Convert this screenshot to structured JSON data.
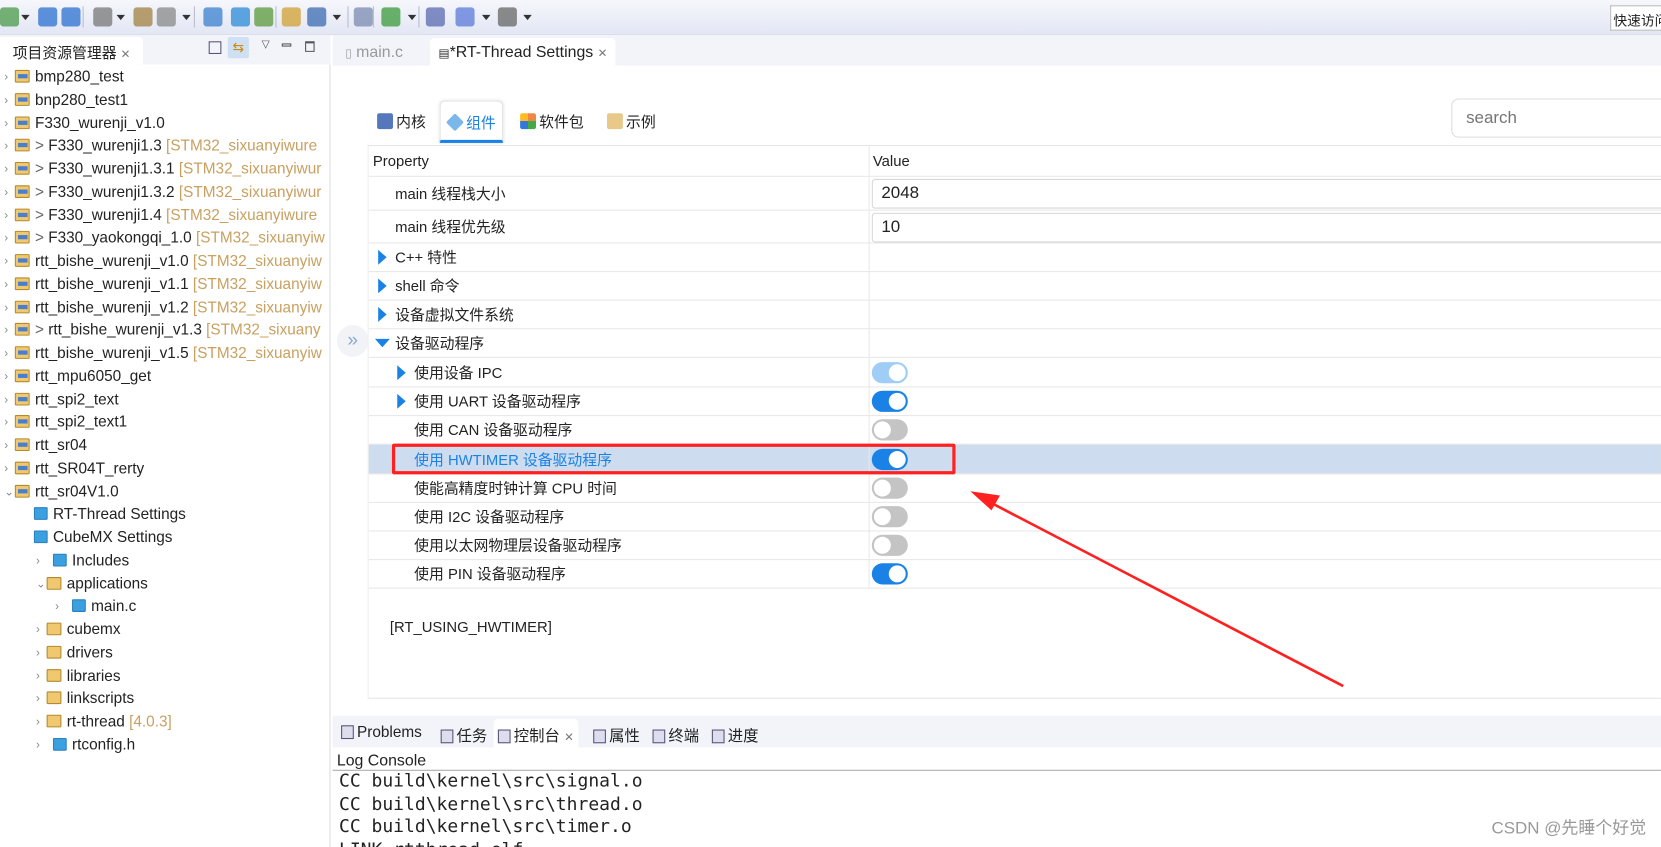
{
  "toolbar": {
    "quick_access": "快速访问"
  },
  "project_explorer": {
    "title": "项目资源管理器",
    "items": [
      {
        "name": "bmp280_test",
        "prefix": "",
        "decoration": ""
      },
      {
        "name": "bnp280_test1",
        "prefix": "",
        "decoration": ""
      },
      {
        "name": "F330_wurenji_v1.0",
        "prefix": "",
        "decoration": ""
      },
      {
        "name": "F330_wurenji1.3",
        "prefix": "> ",
        "decoration": "[STM32_sixuanyiwure"
      },
      {
        "name": "F330_wurenji1.3.1",
        "prefix": "> ",
        "decoration": "[STM32_sixuanyiwur"
      },
      {
        "name": "F330_wurenji1.3.2",
        "prefix": "> ",
        "decoration": "[STM32_sixuanyiwur"
      },
      {
        "name": "F330_wurenji1.4",
        "prefix": "> ",
        "decoration": "[STM32_sixuanyiwure"
      },
      {
        "name": "F330_yaokongqi_1.0",
        "prefix": "> ",
        "decoration": "[STM32_sixuanyiw"
      },
      {
        "name": "rtt_bishe_wurenji_v1.0",
        "prefix": "",
        "decoration": "[STM32_sixuanyiw"
      },
      {
        "name": "rtt_bishe_wurenji_v1.1",
        "prefix": "",
        "decoration": "[STM32_sixuanyiw"
      },
      {
        "name": "rtt_bishe_wurenji_v1.2",
        "prefix": "",
        "decoration": "[STM32_sixuanyiw"
      },
      {
        "name": "rtt_bishe_wurenji_v1.3",
        "prefix": "> ",
        "decoration": "[STM32_sixuany"
      },
      {
        "name": "rtt_bishe_wurenji_v1.5",
        "prefix": "",
        "decoration": "[STM32_sixuanyiw"
      },
      {
        "name": "rtt_mpu6050_get",
        "prefix": "",
        "decoration": ""
      },
      {
        "name": "rtt_spi2_text",
        "prefix": "",
        "decoration": ""
      },
      {
        "name": "rtt_spi2_text1",
        "prefix": "",
        "decoration": ""
      },
      {
        "name": "rtt_sr04",
        "prefix": "",
        "decoration": ""
      },
      {
        "name": "rtt_SR04T_rerty",
        "prefix": "",
        "decoration": ""
      },
      {
        "name": "rtt_sr04V1.0",
        "prefix": "",
        "decoration": ""
      }
    ],
    "children": [
      {
        "name": "RT-Thread Settings",
        "decoration": "",
        "icon": "rt-settings-icon"
      },
      {
        "name": "CubeMX Settings",
        "decoration": "",
        "icon": "cubemx-icon"
      },
      {
        "name": "Includes",
        "decoration": "",
        "icon": "includes-icon"
      },
      {
        "name": "applications",
        "decoration": "",
        "icon": "folder-icon"
      },
      {
        "name": "main.c",
        "decoration": "",
        "icon": "c-file-icon"
      },
      {
        "name": "cubemx",
        "decoration": "",
        "icon": "folder-icon"
      },
      {
        "name": "drivers",
        "decoration": "",
        "icon": "folder-icon"
      },
      {
        "name": "libraries",
        "decoration": "",
        "icon": "folder-icon"
      },
      {
        "name": "linkscripts",
        "decoration": "",
        "icon": "folder-icon"
      },
      {
        "name": "rt-thread",
        "decoration": "[4.0.3]",
        "icon": "folder-icon"
      },
      {
        "name": "rtconfig.h",
        "decoration": "",
        "icon": "h-file-icon"
      }
    ]
  },
  "editor_tabs": [
    {
      "label": "main.c",
      "active": false
    },
    {
      "label": "*RT-Thread Settings",
      "active": true
    }
  ],
  "settings": {
    "tabs": [
      {
        "label": "内核",
        "active": false
      },
      {
        "label": "组件",
        "active": true
      },
      {
        "label": "软件包",
        "active": false
      },
      {
        "label": "示例",
        "active": false
      }
    ],
    "search_placeholder": "search",
    "columns": {
      "property": "Property",
      "value": "Value"
    },
    "rows": [
      {
        "label": "main 线程栈大小",
        "value": "2048"
      },
      {
        "label": "main 线程优先级",
        "value": "10"
      },
      {
        "label": "C++ 特性"
      },
      {
        "label": "shell 命令"
      },
      {
        "label": "设备虚拟文件系统"
      },
      {
        "label": "设备驱动程序",
        "expanded": true
      },
      {
        "label": "使用设备 IPC",
        "toggle": "on-disabled"
      },
      {
        "label": "使用 UART 设备驱动程序",
        "toggle": "on"
      },
      {
        "label": "使用 CAN 设备驱动程序",
        "toggle": "off"
      },
      {
        "label": "使用 HWTIMER 设备驱动程序",
        "toggle": "on",
        "selected": true
      },
      {
        "label": "使能高精度时钟计算 CPU 时间",
        "toggle": "off"
      },
      {
        "label": "使用 I2C 设备驱动程序",
        "toggle": "off"
      },
      {
        "label": "使用以太网物理层设备驱动程序",
        "toggle": "off"
      },
      {
        "label": "使用 PIN 设备驱动程序",
        "toggle": "on"
      }
    ],
    "description": "[RT_USING_HWTIMER]"
  },
  "bottom_panel": {
    "tabs": [
      "Problems",
      "任务",
      "控制台",
      "属性",
      "终端",
      "进度"
    ],
    "console_title": "Log Console",
    "lines": [
      "CC build\\kernel\\src\\signal.o",
      "CC build\\kernel\\src\\thread.o",
      "CC build\\kernel\\src\\timer.o",
      "LINK rtthread.elf"
    ]
  },
  "watermark": "CSDN @先睡个好觉",
  "colors": {
    "accent": "#1a82e6",
    "selection": "#cddcee",
    "highlight_box": "#ff2020",
    "toggle_off": "#c4c4c4"
  }
}
